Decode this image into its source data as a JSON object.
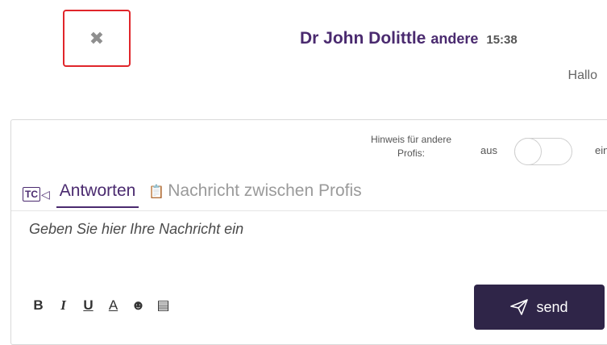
{
  "close": {
    "glyph": "✖",
    "icon": "close-icon"
  },
  "message": {
    "author": "Dr John Dolittle",
    "role": "andere",
    "time": "15:38",
    "text": "Hallo"
  },
  "composer": {
    "hint_label": "Hinweis für andere Profis:",
    "toggle_off_label": "aus",
    "toggle_on_label": "ein",
    "toggle_state": "off",
    "tc_icon_text": "TC",
    "tabs": [
      {
        "label": "Antworten",
        "active": true
      },
      {
        "label": "Nachricht zwischen Profis",
        "active": false
      }
    ],
    "placeholder": "Geben Sie hier Ihre Nachricht ein",
    "format_buttons": [
      {
        "glyph": "B",
        "icon": "bold-icon"
      },
      {
        "glyph": "I",
        "icon": "italic-icon"
      },
      {
        "glyph": "U",
        "icon": "underline-icon"
      },
      {
        "glyph": "A",
        "icon": "text-color-icon"
      },
      {
        "glyph": "☻",
        "icon": "emoji-icon"
      },
      {
        "glyph": "▤",
        "icon": "list-icon"
      }
    ],
    "send_label": "send"
  },
  "colors": {
    "accent": "#4a2a6f",
    "send_bg": "#2f2548",
    "highlight": "#e0262b"
  }
}
